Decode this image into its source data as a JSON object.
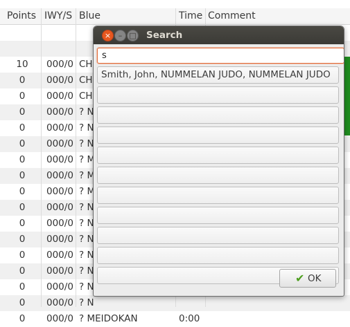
{
  "table": {
    "headers": {
      "points": "Points",
      "iwy": "IWY/S",
      "blue": "Blue",
      "time": "Time",
      "comment": "Comment"
    },
    "rows": [
      {
        "points": "",
        "iwy": "",
        "blue": "",
        "time": ""
      },
      {
        "points": "",
        "iwy": "",
        "blue": "",
        "time": ""
      },
      {
        "points": "10",
        "iwy": "000/0",
        "blue": "CH",
        "time": ""
      },
      {
        "points": "0",
        "iwy": "000/0",
        "blue": "CH",
        "time": ""
      },
      {
        "points": "0",
        "iwy": "000/0",
        "blue": "CH",
        "time": ""
      },
      {
        "points": "0",
        "iwy": "000/0",
        "blue": "? N",
        "time": ""
      },
      {
        "points": "0",
        "iwy": "000/0",
        "blue": "? N",
        "time": ""
      },
      {
        "points": "0",
        "iwy": "000/0",
        "blue": "? N",
        "time": ""
      },
      {
        "points": "0",
        "iwy": "000/0",
        "blue": "? M",
        "time": ""
      },
      {
        "points": "0",
        "iwy": "000/0",
        "blue": "? M",
        "time": ""
      },
      {
        "points": "0",
        "iwy": "000/0",
        "blue": "? M",
        "time": ""
      },
      {
        "points": "0",
        "iwy": "000/0",
        "blue": "? N",
        "time": ""
      },
      {
        "points": "0",
        "iwy": "000/0",
        "blue": "? N",
        "time": ""
      },
      {
        "points": "0",
        "iwy": "000/0",
        "blue": "? N",
        "time": ""
      },
      {
        "points": "0",
        "iwy": "000/0",
        "blue": "? N",
        "time": ""
      },
      {
        "points": "0",
        "iwy": "000/0",
        "blue": "? N",
        "time": ""
      },
      {
        "points": "0",
        "iwy": "000/0",
        "blue": "? N",
        "time": ""
      },
      {
        "points": "0",
        "iwy": "000/0",
        "blue": "? N",
        "time": ""
      },
      {
        "points": "0",
        "iwy": "000/0",
        "blue": "? MEIDOKAN",
        "time": "0:00"
      }
    ],
    "status_color": "#1f8d1f"
  },
  "dialog": {
    "title": "Search",
    "close_glyph": "×",
    "min_glyph": "–",
    "max_glyph": "□",
    "search_value": "s",
    "results": [
      "Smith, John, NUMMELAN JUDO, NUMMELAN JUDO",
      "",
      "",
      "",
      "",
      "",
      "",
      "",
      "",
      "",
      ""
    ],
    "ok_label": "OK",
    "ok_icon": "check-icon",
    "accent": "#e16b3a"
  }
}
